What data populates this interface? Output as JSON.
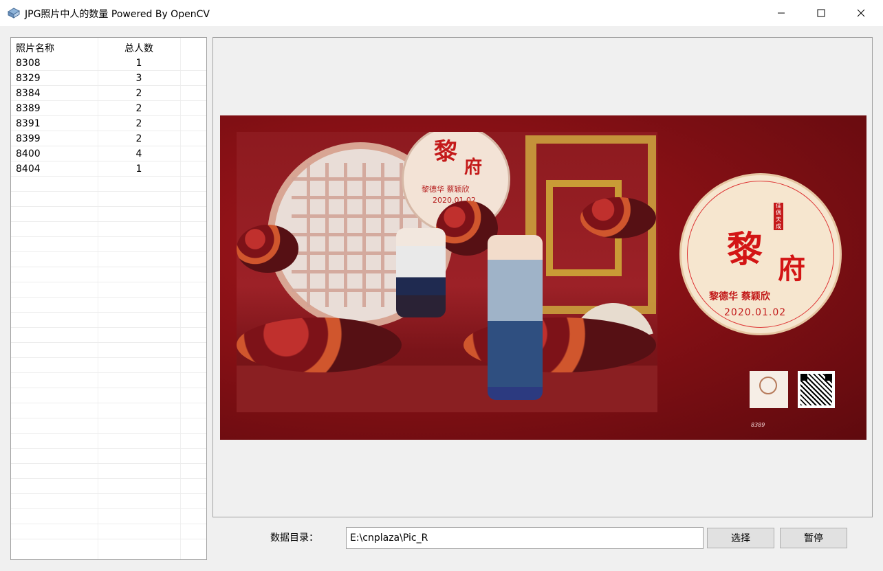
{
  "window": {
    "title": "JPG照片中人的数量  Powered By OpenCV",
    "icon": "app-icon",
    "controls": [
      "minimize-icon",
      "maximize-icon",
      "close-icon"
    ]
  },
  "table": {
    "headers": {
      "name": "照片名称",
      "count": "总人数"
    },
    "rows": [
      {
        "name": "8308",
        "count": "1"
      },
      {
        "name": "8329",
        "count": "3"
      },
      {
        "name": "8384",
        "count": "2"
      },
      {
        "name": "8389",
        "count": "2"
      },
      {
        "name": "8391",
        "count": "2"
      },
      {
        "name": "8399",
        "count": "2"
      },
      {
        "name": "8400",
        "count": "4"
      },
      {
        "name": "8404",
        "count": "1"
      }
    ]
  },
  "preview": {
    "small_sign": {
      "char1": "黎",
      "char2": "府",
      "names": "黎德华 蔡颖欣",
      "date": "2020.01.02"
    },
    "big_sign": {
      "char1": "黎",
      "char2": "府",
      "names": "黎德华 蔡颖欣",
      "date": "2020.01.02",
      "tag": "佳偶天成"
    },
    "photo_code": "8389",
    "colors": {
      "background": "#861015",
      "sign": "#f6e6cf",
      "sign_text": "#d31515"
    }
  },
  "controls": {
    "dir_label": "数据目录：",
    "dir_value": "E:\\cnplaza\\Pic_R",
    "select_button": "选择",
    "pause_button": "暂停"
  }
}
